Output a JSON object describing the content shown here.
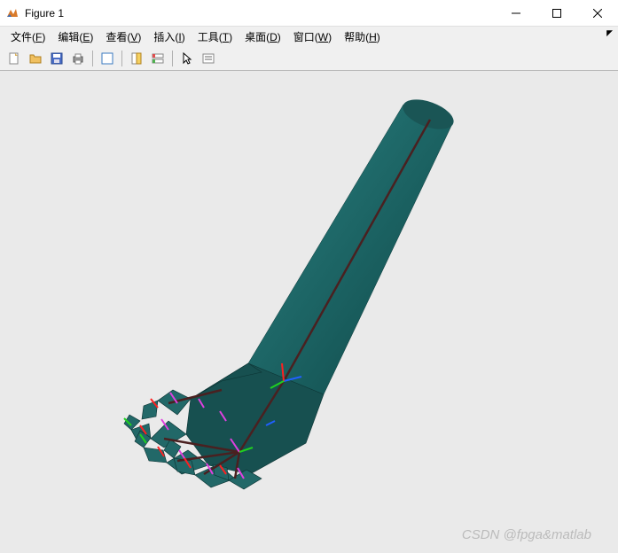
{
  "window": {
    "title": "Figure 1",
    "minimize_tooltip": "Minimize",
    "maximize_tooltip": "Maximize",
    "close_tooltip": "Close"
  },
  "menubar": {
    "file": {
      "label": "文件(",
      "hotkey": "F",
      "suffix": ")"
    },
    "edit": {
      "label": "编辑(",
      "hotkey": "E",
      "suffix": ")"
    },
    "view": {
      "label": "查看(",
      "hotkey": "V",
      "suffix": ")"
    },
    "insert": {
      "label": "插入(",
      "hotkey": "I",
      "suffix": ")"
    },
    "tools": {
      "label": "工具(",
      "hotkey": "T",
      "suffix": ")"
    },
    "desktop": {
      "label": "桌面(",
      "hotkey": "D",
      "suffix": ")"
    },
    "window": {
      "label": "窗口(",
      "hotkey": "W",
      "suffix": ")"
    },
    "help": {
      "label": "帮助(",
      "hotkey": "H",
      "suffix": ")"
    }
  },
  "toolbar": {
    "new": "new-figure",
    "open": "open-file",
    "save": "save-figure",
    "print": "print-figure",
    "edit_plot": "edit-plot",
    "link_axes": "link-axes",
    "insert_colorbar": "insert-colorbar",
    "pointer": "pointer",
    "insert_legend": "insert-legend"
  },
  "canvas": {
    "background": "#eaeaea",
    "model_kind": "3d-hand-arm-skeleton",
    "primary_color": "#1f6a6a"
  },
  "watermark": "CSDN @fpga&matlab"
}
